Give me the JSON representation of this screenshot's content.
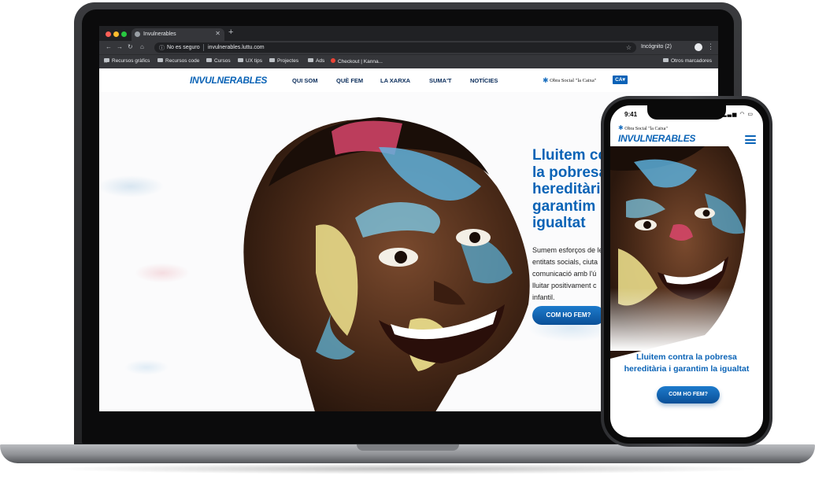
{
  "browser": {
    "tab_title": "Invulnerables",
    "security_label": "No es seguro",
    "url": "invulnerables.luttu.com",
    "incognito_label": "Incógnito (2)",
    "bookmarks": [
      {
        "label": "Recursos gràfics"
      },
      {
        "label": "Recursos code"
      },
      {
        "label": "Cursos"
      },
      {
        "label": "UX tips"
      },
      {
        "label": "Projectes"
      },
      {
        "label": "Ads"
      },
      {
        "label": "Checkout | Kanna..."
      }
    ],
    "other_bookmarks": "Otros marcadores"
  },
  "site": {
    "logo_strong": "INVUL",
    "logo_rest": "NERABLES",
    "nav": [
      {
        "label": "QUI SOM"
      },
      {
        "label": "QUÈ FEM"
      },
      {
        "label": "LA XARXA"
      },
      {
        "label": "SUMA'T"
      },
      {
        "label": "NOTÍCIES"
      }
    ],
    "partner_logo": "Obra Social \"la Caixa\"",
    "language": "CA",
    "hero_title": "Lluitem co\nla pobresa\nhereditàri\ngarantim\nigualtat",
    "hero_text": "Sumem esforços de le\nentitats socials, ciuta\ncomunicació amb l'ú\nlluitar positivament c\ninfantil.",
    "hero_cta": "COM HO FEM?"
  },
  "mobile": {
    "time": "9:41",
    "partner_logo": "Obra Social \"la Caixa\"",
    "logo_strong": "INVUL",
    "logo_rest": "NERABLES",
    "hero_title": "Lluitem contra la pobresa\nhereditària i garantim la igualtat",
    "cta": "COM HO FEM?"
  },
  "colors": {
    "brand_blue": "#0a63b6",
    "nav_dark": "#0b2d5b",
    "browser_dark": "#202124"
  }
}
